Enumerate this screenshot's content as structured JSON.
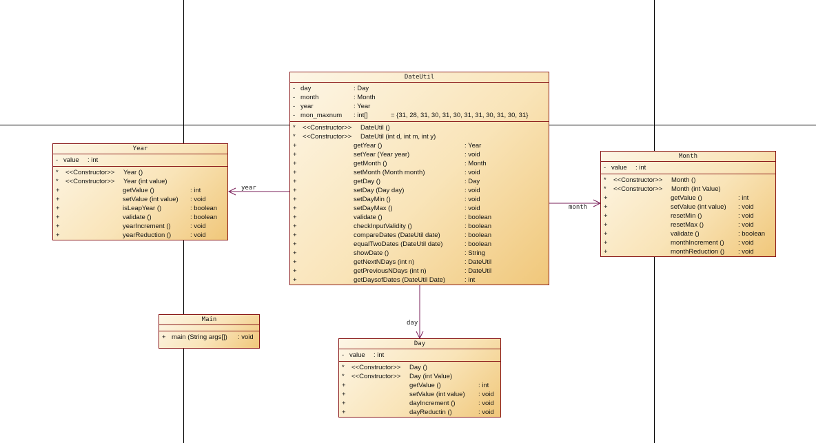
{
  "diagram": {
    "classes": {
      "dateutil": {
        "name": "DateUtil",
        "attributes": [
          {
            "vis": "-",
            "name": "day",
            "type": ": Day",
            "init": ""
          },
          {
            "vis": "-",
            "name": "month",
            "type": ": Month",
            "init": ""
          },
          {
            "vis": "-",
            "name": "year",
            "type": ": Year",
            "init": ""
          },
          {
            "vis": "-",
            "name": "mon_maxnum",
            "type": ": int[]",
            "init": "= {31, 28, 31, 30, 31, 30, 31, 31, 30, 31, 30, 31}"
          }
        ],
        "operations": [
          {
            "vis": "*",
            "stereo": "<<Constructor>>",
            "name": "DateUtil ()",
            "ret": ""
          },
          {
            "vis": "*",
            "stereo": "<<Constructor>>",
            "name": "DateUtil (int d, int m, int y)",
            "ret": ""
          },
          {
            "vis": "+",
            "stereo": "",
            "name": "getYear ()",
            "ret": ": Year"
          },
          {
            "vis": "+",
            "stereo": "",
            "name": "setYear (Year year)",
            "ret": ": void"
          },
          {
            "vis": "+",
            "stereo": "",
            "name": "getMonth ()",
            "ret": ": Month"
          },
          {
            "vis": "+",
            "stereo": "",
            "name": "setMonth (Month month)",
            "ret": ": void"
          },
          {
            "vis": "+",
            "stereo": "",
            "name": "getDay ()",
            "ret": ": Day"
          },
          {
            "vis": "+",
            "stereo": "",
            "name": "setDay (Day day)",
            "ret": ": void"
          },
          {
            "vis": "+",
            "stereo": "",
            "name": "setDayMin ()",
            "ret": ": void"
          },
          {
            "vis": "+",
            "stereo": "",
            "name": "setDayMax ()",
            "ret": ": void"
          },
          {
            "vis": "+",
            "stereo": "",
            "name": "validate ()",
            "ret": ": boolean"
          },
          {
            "vis": "+",
            "stereo": "",
            "name": "checkInputValidity ()",
            "ret": ": boolean"
          },
          {
            "vis": "+",
            "stereo": "",
            "name": "compareDates (DateUtil date)",
            "ret": ": boolean"
          },
          {
            "vis": "+",
            "stereo": "",
            "name": "equalTwoDates (DateUtil date)",
            "ret": ": boolean"
          },
          {
            "vis": "+",
            "stereo": "",
            "name": "showDate ()",
            "ret": ": String"
          },
          {
            "vis": "+",
            "stereo": "",
            "name": "getNextNDays (int n)",
            "ret": ": DateUtil"
          },
          {
            "vis": "+",
            "stereo": "",
            "name": "getPreviousNDays (int n)",
            "ret": ": DateUtil"
          },
          {
            "vis": "+",
            "stereo": "",
            "name": "getDaysofDates (DateUtil Date)",
            "ret": ": int"
          }
        ]
      },
      "year": {
        "name": "Year",
        "attributes": [
          {
            "vis": "-",
            "name": "value",
            "type": ": int",
            "init": ""
          }
        ],
        "operations": [
          {
            "vis": "*",
            "stereo": "<<Constructor>>",
            "name": "Year ()",
            "ret": ""
          },
          {
            "vis": "*",
            "stereo": "<<Constructor>>",
            "name": "Year (int value)",
            "ret": ""
          },
          {
            "vis": "+",
            "stereo": "",
            "name": "getValue ()",
            "ret": ": int"
          },
          {
            "vis": "+",
            "stereo": "",
            "name": "setValue (int value)",
            "ret": ": void"
          },
          {
            "vis": "+",
            "stereo": "",
            "name": "isLeapYear ()",
            "ret": ": boolean"
          },
          {
            "vis": "+",
            "stereo": "",
            "name": "validate ()",
            "ret": ": boolean"
          },
          {
            "vis": "+",
            "stereo": "",
            "name": "yearIncrement ()",
            "ret": ": void"
          },
          {
            "vis": "+",
            "stereo": "",
            "name": "yearReduction ()",
            "ret": ": void"
          }
        ]
      },
      "month": {
        "name": "Month",
        "attributes": [
          {
            "vis": "-",
            "name": "value",
            "type": ": int",
            "init": ""
          }
        ],
        "operations": [
          {
            "vis": "*",
            "stereo": "<<Constructor>>",
            "name": "Month ()",
            "ret": ""
          },
          {
            "vis": "*",
            "stereo": "<<Constructor>>",
            "name": "Month (int Value)",
            "ret": ""
          },
          {
            "vis": "+",
            "stereo": "",
            "name": "getValue ()",
            "ret": ": int"
          },
          {
            "vis": "+",
            "stereo": "",
            "name": "setValue (int value)",
            "ret": ": void"
          },
          {
            "vis": "+",
            "stereo": "",
            "name": "resetMin ()",
            "ret": ": void"
          },
          {
            "vis": "+",
            "stereo": "",
            "name": "resetMax ()",
            "ret": ": void"
          },
          {
            "vis": "+",
            "stereo": "",
            "name": "validate ()",
            "ret": ": boolean"
          },
          {
            "vis": "+",
            "stereo": "",
            "name": "monthIncrement ()",
            "ret": ": void"
          },
          {
            "vis": "+",
            "stereo": "",
            "name": "monthReduction ()",
            "ret": ": void"
          }
        ]
      },
      "day": {
        "name": "Day",
        "attributes": [
          {
            "vis": "-",
            "name": "value",
            "type": ": int",
            "init": ""
          }
        ],
        "operations": [
          {
            "vis": "*",
            "stereo": "<<Constructor>>",
            "name": "Day ()",
            "ret": ""
          },
          {
            "vis": "*",
            "stereo": "<<Constructor>>",
            "name": "Day (int Value)",
            "ret": ""
          },
          {
            "vis": "+",
            "stereo": "",
            "name": "getValue ()",
            "ret": ": int"
          },
          {
            "vis": "+",
            "stereo": "",
            "name": "setValue (int value)",
            "ret": ": void"
          },
          {
            "vis": "+",
            "stereo": "",
            "name": "dayIncrement ()",
            "ret": ": void"
          },
          {
            "vis": "+",
            "stereo": "",
            "name": "dayReductin ()",
            "ret": ": void"
          }
        ]
      },
      "main": {
        "name": "Main",
        "attributes": [],
        "operations": [
          {
            "vis": "+",
            "stereo": "",
            "name": "main (String args[])",
            "ret": ": void"
          }
        ]
      }
    },
    "associations": {
      "year": "year",
      "month": "month",
      "day": "day"
    },
    "colors": {
      "border": "#8b1a1a",
      "fill_light": "#fdf6e6",
      "fill_dark": "#f0c77a",
      "line": "#7a1f5a"
    }
  }
}
